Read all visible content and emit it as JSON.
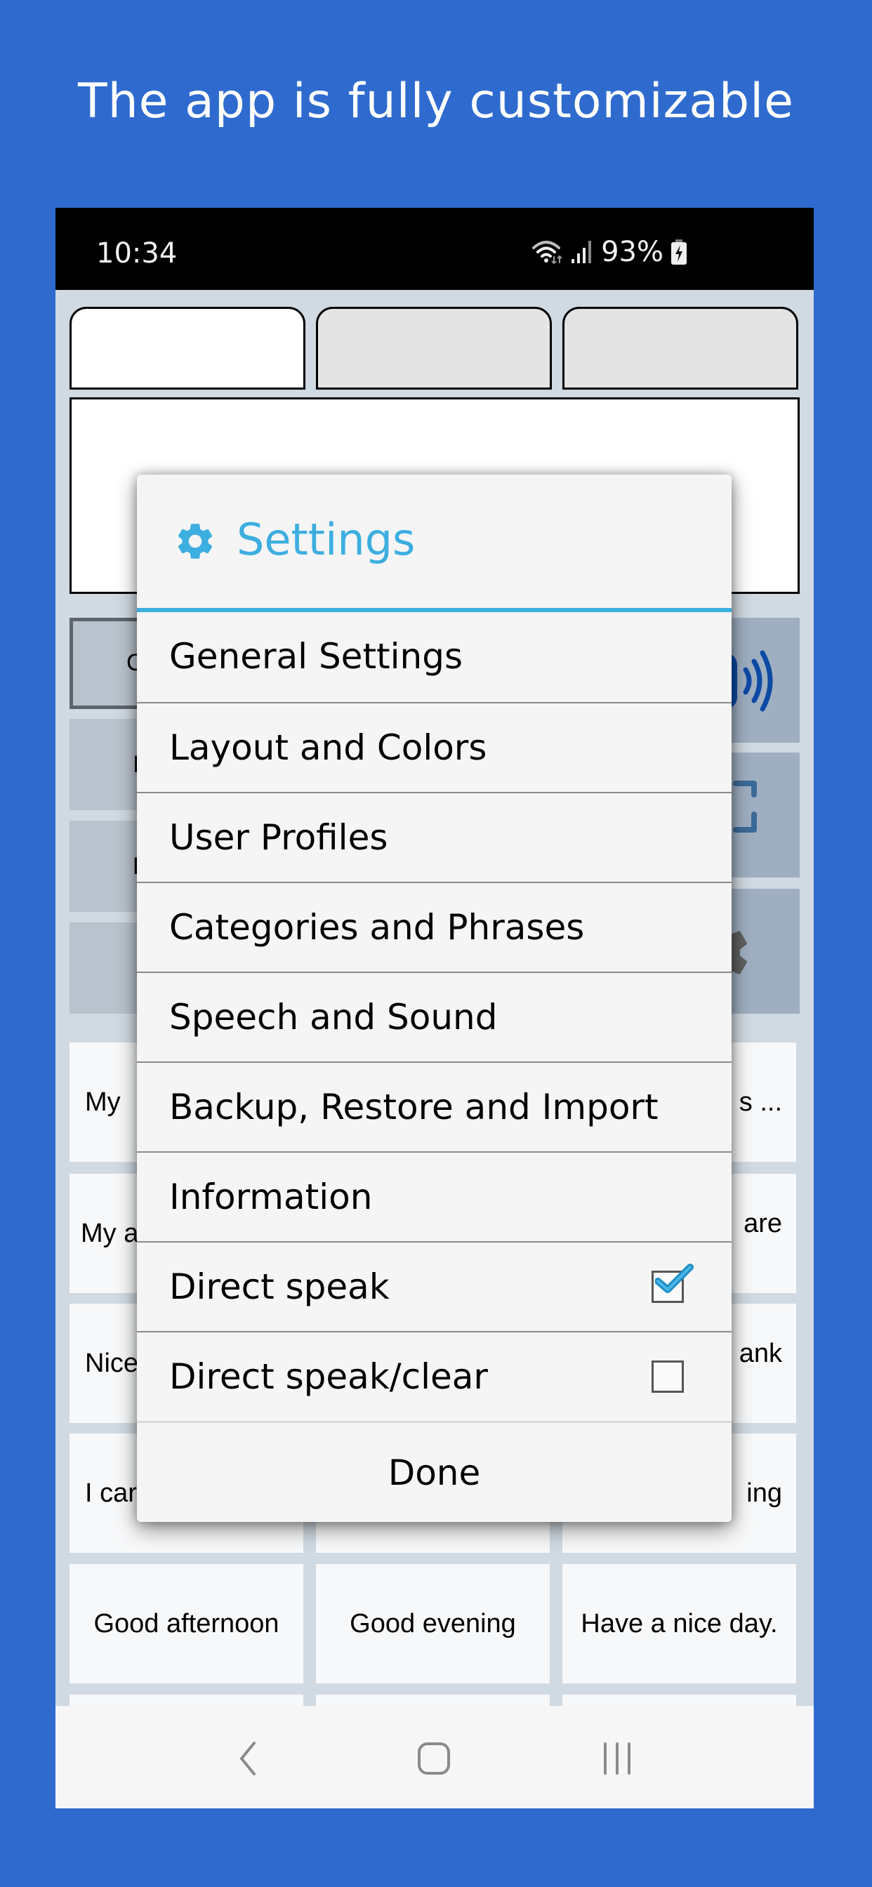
{
  "promo": {
    "title": "The app is fully customizable"
  },
  "status_bar": {
    "time": "10:34",
    "battery_percent": "93%",
    "icons": [
      "wifi-icon",
      "signal-icon",
      "battery-charging-icon"
    ]
  },
  "tabs": [
    {
      "label": "",
      "active": true
    },
    {
      "label": "",
      "active": false
    },
    {
      "label": "",
      "active": false
    }
  ],
  "text_input": {
    "value": ""
  },
  "control_buttons": {
    "left_peeks": [
      "C",
      "I",
      "F",
      ""
    ],
    "right_icons": [
      "speaker-icon",
      "fullscreen-icon",
      "gear-icon"
    ]
  },
  "phrases": {
    "rows": [
      [
        "My",
        "",
        "s ..."
      ],
      [
        "My a",
        "",
        "are"
      ],
      [
        "Nice",
        "",
        "ank"
      ],
      [
        "I car",
        "",
        "ing"
      ],
      [
        "Good afternoon",
        "Good evening",
        "Have a nice day."
      ],
      [
        "",
        "",
        ""
      ]
    ]
  },
  "settings_dialog": {
    "title": "Settings",
    "icon": "gear-icon",
    "accent_color": "#3DAEE0",
    "items": [
      {
        "label": "General Settings"
      },
      {
        "label": "Layout and Colors"
      },
      {
        "label": "User Profiles"
      },
      {
        "label": "Categories and Phrases"
      },
      {
        "label": "Speech and Sound"
      },
      {
        "label": "Backup, Restore and Import"
      },
      {
        "label": "Information"
      },
      {
        "label": "Direct speak",
        "checkbox": true,
        "checked": true
      },
      {
        "label": "Direct speak/clear",
        "checkbox": true,
        "checked": false
      }
    ],
    "done_label": "Done"
  },
  "nav_bar": {
    "buttons": [
      "back-icon",
      "home-icon",
      "recents-icon"
    ]
  },
  "colors": {
    "background": "#2F6BCF",
    "app_background": "#D0DAE2",
    "speaker_icon": "#0D4AA5"
  }
}
